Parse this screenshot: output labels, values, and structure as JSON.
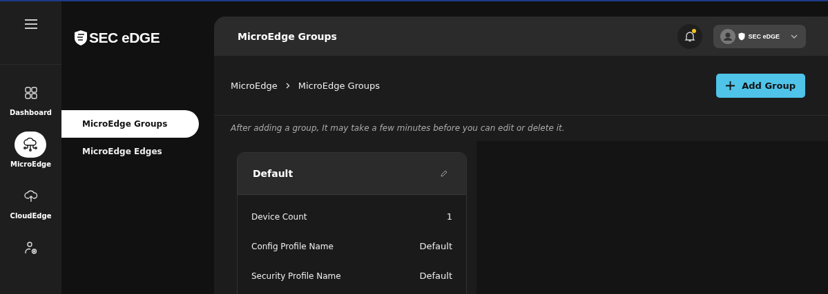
{
  "brand": {
    "name": "SEC eDGE"
  },
  "rail": [
    {
      "kind": "grid",
      "label": "Dashboard",
      "selected": false
    },
    {
      "kind": "network",
      "label": "MicroEdge",
      "selected": true
    },
    {
      "kind": "upload",
      "label": "CloudEdge",
      "selected": false
    },
    {
      "kind": "usergear",
      "selected": false
    }
  ],
  "submenu": [
    {
      "label": "MicroEdge Groups",
      "selected": true
    },
    {
      "label": "MicroEdge Edges",
      "selected": false
    }
  ],
  "header": {
    "title": "MicroEdge Groups",
    "notification": true,
    "account": "SEC eDGE"
  },
  "breadcrumb": [
    "MicroEdge",
    "MicroEdge Groups"
  ],
  "add_button": "Add Group",
  "note": "After adding a group, It may take a few minutes before you can edit or delete it.",
  "groups": [
    {
      "name": "Default",
      "fields": [
        {
          "label": "Device Count",
          "value": "1"
        },
        {
          "label": "Config Profile Name",
          "value": "Default"
        },
        {
          "label": "Security Profile Name",
          "value": "Default"
        }
      ]
    }
  ]
}
